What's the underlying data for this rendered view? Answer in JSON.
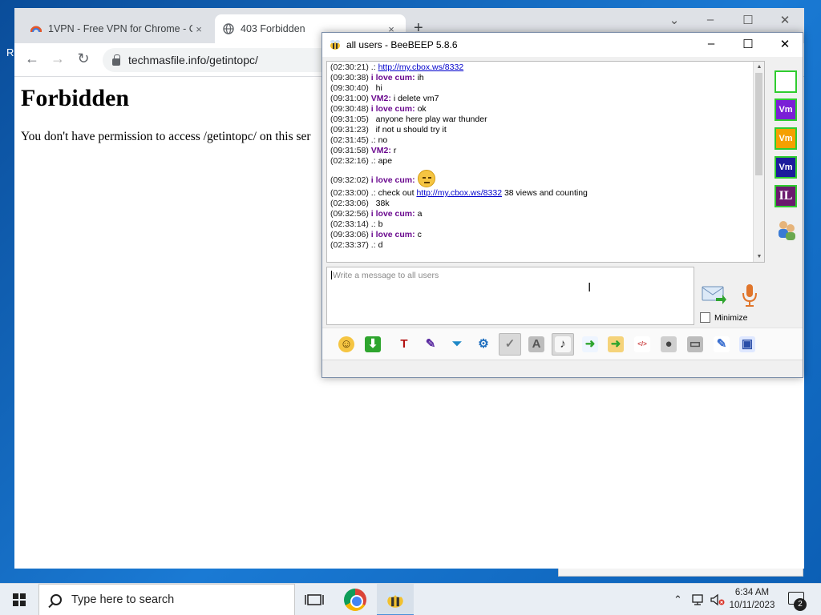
{
  "desktop": {
    "edge_letter": "R"
  },
  "chrome": {
    "tabs": [
      {
        "title": "1VPN - Free VPN for Chrome - C",
        "close": "×"
      },
      {
        "title": "403 Forbidden",
        "close": "×"
      }
    ],
    "new_tab": "+",
    "address": "techmasfile.info/getintopc/",
    "page": {
      "heading": "Forbidden",
      "message": "You don't have permission to access /getintopc/ on this ser"
    }
  },
  "beebeep": {
    "title": "all users - BeeBEEP 5.8.6",
    "messages": [
      {
        "ts": "(02:30:21)",
        "nick": ".:",
        "text": "",
        "link": "http://my.cbox.ws/8332",
        "after": ""
      },
      {
        "ts": "(09:30:38)",
        "nick": "i love cum:",
        "text": "ih",
        "link": "",
        "after": ""
      },
      {
        "ts": "(09:30:40)",
        "nick": "",
        "text": "hi",
        "link": "",
        "after": ""
      },
      {
        "ts": "(09:31:00)",
        "nick": "VM2:",
        "text": "i delete vm7",
        "link": "",
        "after": ""
      },
      {
        "ts": "(09:30:48)",
        "nick": "i love cum:",
        "text": "ok",
        "link": "",
        "after": ""
      },
      {
        "ts": "(09:31:05)",
        "nick": "",
        "text": "anyone here play war thunder",
        "link": "",
        "after": ""
      },
      {
        "ts": "(09:31:23)",
        "nick": "",
        "text": "if not u should try it",
        "link": "",
        "after": ""
      },
      {
        "ts": "(02:31:45)",
        "nick": ".:",
        "text": "no",
        "link": "",
        "after": ""
      },
      {
        "ts": "(09:31:58)",
        "nick": "VM2:",
        "text": "r",
        "link": "",
        "after": ""
      },
      {
        "ts": "(02:32:16)",
        "nick": ".:",
        "text": "ape",
        "link": "",
        "after": ""
      },
      {
        "ts": "(09:32:02)",
        "nick": "i love cum:",
        "text": "",
        "link": "",
        "after": "",
        "emoji": "pensive-emoji"
      },
      {
        "ts": "(02:33:00)",
        "nick": ".:",
        "text": "check out",
        "link": "http://my.cbox.ws/8332",
        "after": "38 views and counting"
      },
      {
        "ts": "(02:33:06)",
        "nick": "",
        "text": "38k",
        "link": "",
        "after": ""
      },
      {
        "ts": "(09:32:56)",
        "nick": "i love cum:",
        "text": "a",
        "link": "",
        "after": ""
      },
      {
        "ts": "(02:33:14)",
        "nick": ".:",
        "text": "b",
        "link": "",
        "after": ""
      },
      {
        "ts": "(09:33:06)",
        "nick": "i love cum:",
        "text": "c",
        "link": "",
        "after": ""
      },
      {
        "ts": "(02:33:37)",
        "nick": ".:",
        "text": "d",
        "link": "",
        "after": ""
      }
    ],
    "input_placeholder": "Write a message to all users",
    "minimize_label": "Minimize",
    "sidebar_users": [
      {
        "label": "",
        "bg": "#ffffff",
        "fg": "#000000"
      },
      {
        "label": "Vm",
        "bg": "#7a1fd6",
        "fg": "#ffffff"
      },
      {
        "label": "Vm",
        "bg": "#f5a000",
        "fg": "#ffffff"
      },
      {
        "label": "Vm",
        "bg": "#1c1c9c",
        "fg": "#ffffff"
      },
      {
        "label": "IL",
        "bg": "#6a1a6e",
        "fg": "#ffffff"
      }
    ],
    "toolbar_icons": [
      "emoji-icon",
      "download-icon",
      "font-icon",
      "color-icon",
      "filter-icon",
      "settings-icon",
      "spellcheck-icon",
      "dictionary-icon",
      "note-icon",
      "send-file-icon",
      "send-folder-icon",
      "code-icon",
      "screenshot-icon",
      "terminal-icon",
      "edit-icon",
      "save-icon"
    ]
  },
  "taskbar": {
    "search_placeholder": "Type here to search",
    "time": "6:34 AM",
    "date": "10/11/2023",
    "notification_count": "2"
  }
}
